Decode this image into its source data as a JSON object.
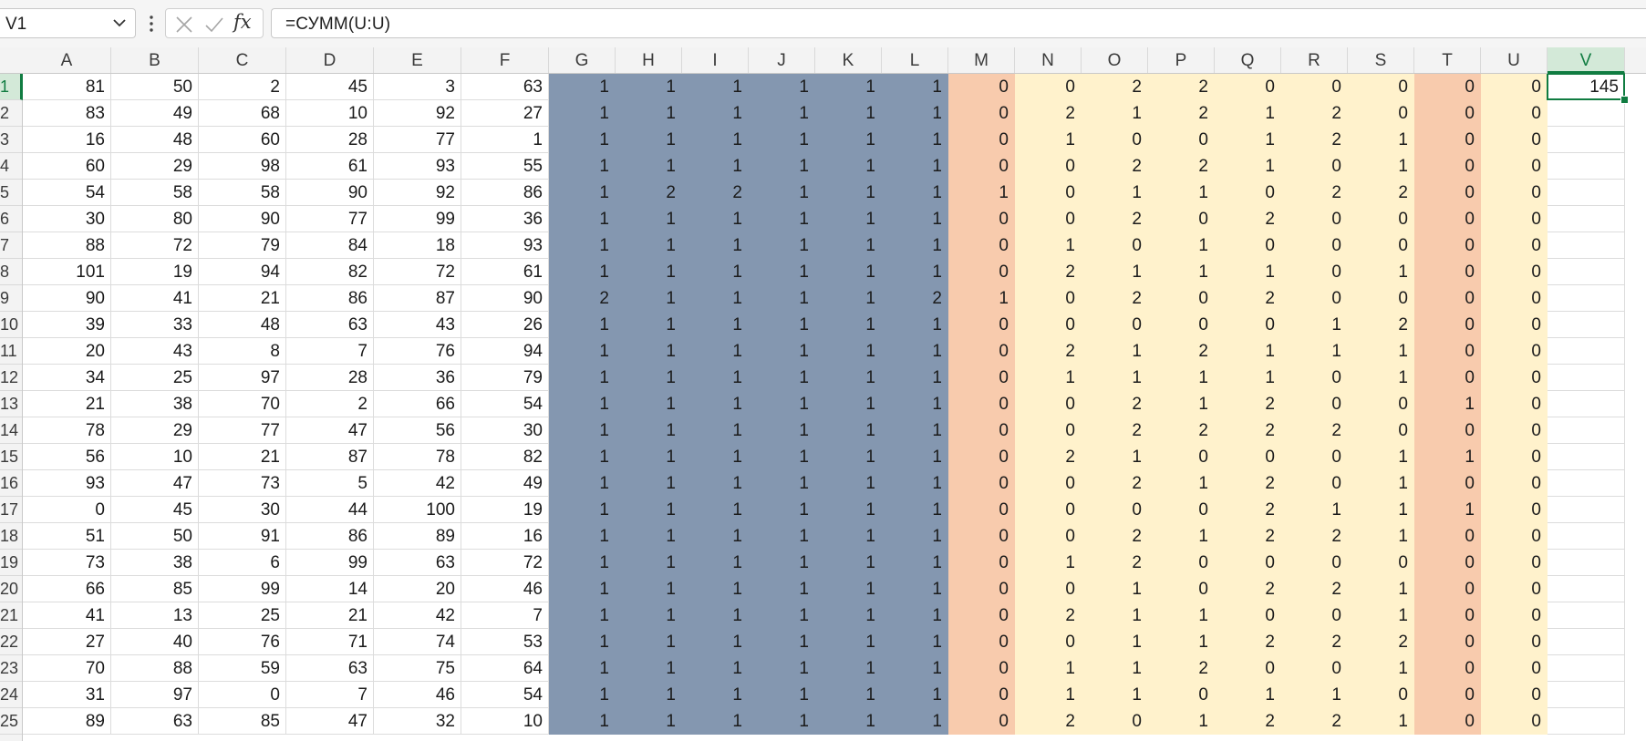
{
  "formula_bar": {
    "name_box": "V1",
    "fx_label": "fx",
    "formula": "=СУММ(U:U)"
  },
  "selected": {
    "col": "V",
    "row": 1
  },
  "columns": [
    "A",
    "B",
    "C",
    "D",
    "E",
    "F",
    "G",
    "H",
    "I",
    "J",
    "K",
    "L",
    "M",
    "N",
    "O",
    "P",
    "Q",
    "R",
    "S",
    "T",
    "U",
    "V"
  ],
  "row_numbers": [
    1,
    2,
    3,
    4,
    5,
    6,
    7,
    8,
    9,
    10,
    11,
    12,
    13,
    14,
    15,
    16,
    17,
    18,
    19,
    20,
    21,
    22,
    23,
    24,
    25
  ],
  "fill_colors": {
    "blue": "#8497b0",
    "orange": "#f8cbad",
    "yellow": "#fff2cc",
    "accent": "#107c41"
  },
  "column_fills": {
    "G": "blue",
    "H": "blue",
    "I": "blue",
    "J": "blue",
    "K": "blue",
    "L": "blue",
    "M": "orange",
    "N": "yellow",
    "O": "yellow",
    "P": "yellow",
    "Q": "yellow",
    "R": "yellow",
    "S": "yellow",
    "T": "orange",
    "U": "yellow"
  },
  "rows": [
    [
      "81",
      "50",
      "2",
      "45",
      "3",
      "63",
      "1",
      "1",
      "1",
      "1",
      "1",
      "1",
      "0",
      "0",
      "2",
      "2",
      "0",
      "0",
      "0",
      "0",
      "0",
      "145"
    ],
    [
      "83",
      "49",
      "68",
      "10",
      "92",
      "27",
      "1",
      "1",
      "1",
      "1",
      "1",
      "1",
      "0",
      "2",
      "1",
      "2",
      "1",
      "2",
      "0",
      "0",
      "0",
      ""
    ],
    [
      "16",
      "48",
      "60",
      "28",
      "77",
      "1",
      "1",
      "1",
      "1",
      "1",
      "1",
      "1",
      "0",
      "1",
      "0",
      "0",
      "1",
      "2",
      "1",
      "0",
      "0",
      ""
    ],
    [
      "60",
      "29",
      "98",
      "61",
      "93",
      "55",
      "1",
      "1",
      "1",
      "1",
      "1",
      "1",
      "0",
      "0",
      "2",
      "2",
      "1",
      "0",
      "1",
      "0",
      "0",
      ""
    ],
    [
      "54",
      "58",
      "58",
      "90",
      "92",
      "86",
      "1",
      "2",
      "2",
      "1",
      "1",
      "1",
      "1",
      "0",
      "1",
      "1",
      "0",
      "2",
      "2",
      "0",
      "0",
      ""
    ],
    [
      "30",
      "80",
      "90",
      "77",
      "99",
      "36",
      "1",
      "1",
      "1",
      "1",
      "1",
      "1",
      "0",
      "0",
      "2",
      "0",
      "2",
      "0",
      "0",
      "0",
      "0",
      ""
    ],
    [
      "88",
      "72",
      "79",
      "84",
      "18",
      "93",
      "1",
      "1",
      "1",
      "1",
      "1",
      "1",
      "0",
      "1",
      "0",
      "1",
      "0",
      "0",
      "0",
      "0",
      "0",
      ""
    ],
    [
      "101",
      "19",
      "94",
      "82",
      "72",
      "61",
      "1",
      "1",
      "1",
      "1",
      "1",
      "1",
      "0",
      "2",
      "1",
      "1",
      "1",
      "0",
      "1",
      "0",
      "0",
      ""
    ],
    [
      "90",
      "41",
      "21",
      "86",
      "87",
      "90",
      "2",
      "1",
      "1",
      "1",
      "1",
      "2",
      "1",
      "0",
      "2",
      "0",
      "2",
      "0",
      "0",
      "0",
      "0",
      ""
    ],
    [
      "39",
      "33",
      "48",
      "63",
      "43",
      "26",
      "1",
      "1",
      "1",
      "1",
      "1",
      "1",
      "0",
      "0",
      "0",
      "0",
      "0",
      "1",
      "2",
      "0",
      "0",
      ""
    ],
    [
      "20",
      "43",
      "8",
      "7",
      "76",
      "94",
      "1",
      "1",
      "1",
      "1",
      "1",
      "1",
      "0",
      "2",
      "1",
      "2",
      "1",
      "1",
      "1",
      "0",
      "0",
      ""
    ],
    [
      "34",
      "25",
      "97",
      "28",
      "36",
      "79",
      "1",
      "1",
      "1",
      "1",
      "1",
      "1",
      "0",
      "1",
      "1",
      "1",
      "1",
      "0",
      "1",
      "0",
      "0",
      ""
    ],
    [
      "21",
      "38",
      "70",
      "2",
      "66",
      "54",
      "1",
      "1",
      "1",
      "1",
      "1",
      "1",
      "0",
      "0",
      "2",
      "1",
      "2",
      "0",
      "0",
      "1",
      "0",
      ""
    ],
    [
      "78",
      "29",
      "77",
      "47",
      "56",
      "30",
      "1",
      "1",
      "1",
      "1",
      "1",
      "1",
      "0",
      "0",
      "2",
      "2",
      "2",
      "2",
      "0",
      "0",
      "0",
      ""
    ],
    [
      "56",
      "10",
      "21",
      "87",
      "78",
      "82",
      "1",
      "1",
      "1",
      "1",
      "1",
      "1",
      "0",
      "2",
      "1",
      "0",
      "0",
      "0",
      "1",
      "1",
      "0",
      ""
    ],
    [
      "93",
      "47",
      "73",
      "5",
      "42",
      "49",
      "1",
      "1",
      "1",
      "1",
      "1",
      "1",
      "0",
      "0",
      "2",
      "1",
      "2",
      "0",
      "1",
      "0",
      "0",
      ""
    ],
    [
      "0",
      "45",
      "30",
      "44",
      "100",
      "19",
      "1",
      "1",
      "1",
      "1",
      "1",
      "1",
      "0",
      "0",
      "0",
      "0",
      "2",
      "1",
      "1",
      "1",
      "0",
      ""
    ],
    [
      "51",
      "50",
      "91",
      "86",
      "89",
      "16",
      "1",
      "1",
      "1",
      "1",
      "1",
      "1",
      "0",
      "0",
      "2",
      "1",
      "2",
      "2",
      "1",
      "0",
      "0",
      ""
    ],
    [
      "73",
      "38",
      "6",
      "99",
      "63",
      "72",
      "1",
      "1",
      "1",
      "1",
      "1",
      "1",
      "0",
      "1",
      "2",
      "0",
      "0",
      "0",
      "0",
      "0",
      "0",
      ""
    ],
    [
      "66",
      "85",
      "99",
      "14",
      "20",
      "46",
      "1",
      "1",
      "1",
      "1",
      "1",
      "1",
      "0",
      "0",
      "1",
      "0",
      "2",
      "2",
      "1",
      "0",
      "0",
      ""
    ],
    [
      "41",
      "13",
      "25",
      "21",
      "42",
      "7",
      "1",
      "1",
      "1",
      "1",
      "1",
      "1",
      "0",
      "2",
      "1",
      "1",
      "0",
      "0",
      "1",
      "0",
      "0",
      ""
    ],
    [
      "27",
      "40",
      "76",
      "71",
      "74",
      "53",
      "1",
      "1",
      "1",
      "1",
      "1",
      "1",
      "0",
      "0",
      "1",
      "1",
      "2",
      "2",
      "2",
      "0",
      "0",
      ""
    ],
    [
      "70",
      "88",
      "59",
      "63",
      "75",
      "64",
      "1",
      "1",
      "1",
      "1",
      "1",
      "1",
      "0",
      "1",
      "1",
      "2",
      "0",
      "0",
      "1",
      "0",
      "0",
      ""
    ],
    [
      "31",
      "97",
      "0",
      "7",
      "46",
      "54",
      "1",
      "1",
      "1",
      "1",
      "1",
      "1",
      "0",
      "1",
      "1",
      "0",
      "1",
      "1",
      "0",
      "0",
      "0",
      ""
    ],
    [
      "89",
      "63",
      "85",
      "47",
      "32",
      "10",
      "1",
      "1",
      "1",
      "1",
      "1",
      "1",
      "0",
      "2",
      "0",
      "1",
      "2",
      "2",
      "1",
      "0",
      "0",
      ""
    ]
  ]
}
